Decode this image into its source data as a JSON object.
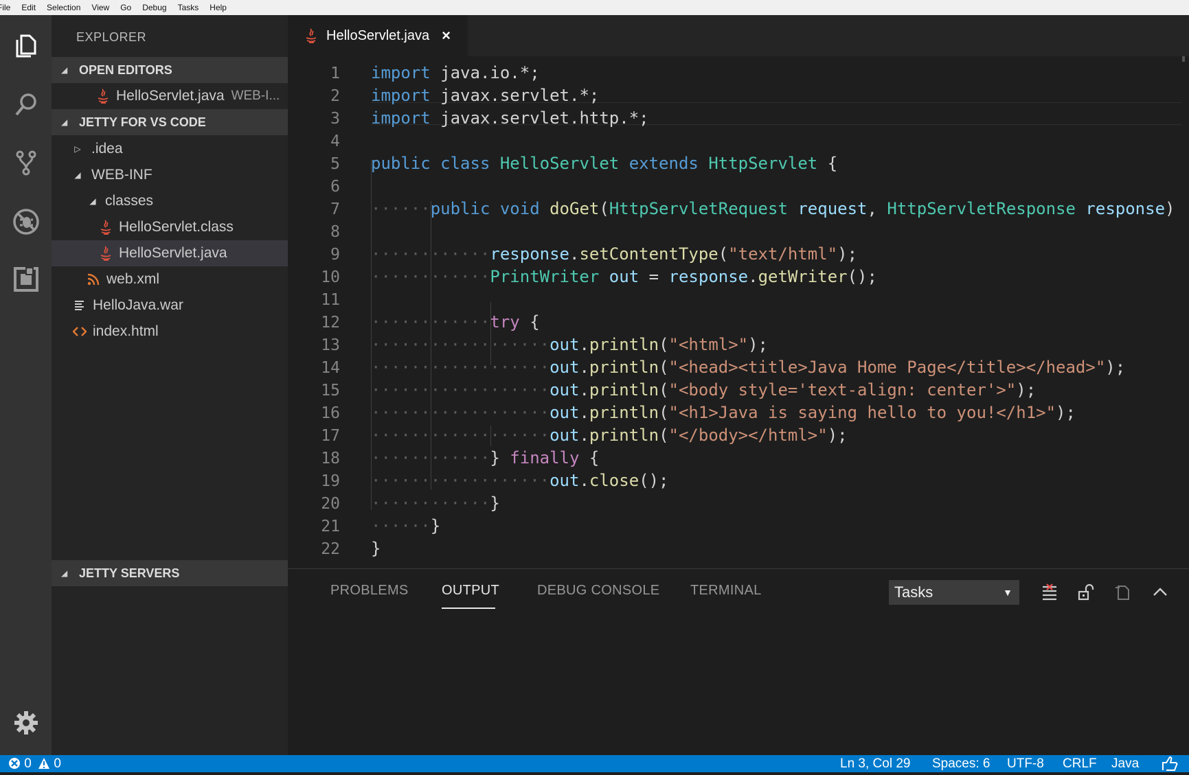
{
  "menubar": [
    "File",
    "Edit",
    "Selection",
    "View",
    "Go",
    "Debug",
    "Tasks",
    "Help"
  ],
  "activity_bar": {
    "items": [
      "files-icon",
      "search-icon",
      "source-control-icon",
      "debug-icon",
      "extensions-icon"
    ],
    "bottom": "settings-gear-icon"
  },
  "sidebar": {
    "title": "EXPLORER",
    "open_editors": {
      "header": "OPEN EDITORS",
      "items": [
        {
          "label": "HelloServlet.java",
          "description": "WEB-I..."
        }
      ]
    },
    "project": {
      "header": "JETTY FOR VS CODE",
      "items": [
        {
          "label": ".idea",
          "icon": "folder-collapsed"
        },
        {
          "label": "WEB-INF",
          "icon": "folder-expanded"
        },
        {
          "label": "classes",
          "icon": "folder-expanded"
        },
        {
          "label": "HelloServlet.class",
          "icon": "java-icon"
        },
        {
          "label": "HelloServlet.java",
          "icon": "java-icon",
          "selected": true
        },
        {
          "label": "web.xml",
          "icon": "xml-rss-icon"
        },
        {
          "label": "HelloJava.war",
          "icon": "file-lines-icon"
        },
        {
          "label": "index.html",
          "icon": "html-icon"
        }
      ]
    },
    "servers_header": "JETTY SERVERS"
  },
  "editor": {
    "tab": {
      "label": "HelloServlet.java",
      "close": "×"
    },
    "line_numbers": [
      "1",
      "2",
      "3",
      "4",
      "5",
      "6",
      "7",
      "8",
      "9",
      "10",
      "11",
      "12",
      "13",
      "14",
      "15",
      "16",
      "17",
      "18",
      "19",
      "20",
      "21",
      "22"
    ],
    "code": {
      "l1": {
        "a": "import",
        "b": " java.io.*;"
      },
      "l2": {
        "a": "import",
        "b": " javax.servlet.*;"
      },
      "l3": {
        "a": "import",
        "b": " javax.servlet.http.*;"
      },
      "l5": {
        "a": "public",
        "b": "class",
        "c": "HelloServlet",
        "d": "extends",
        "e": "HttpServlet",
        "f": " {"
      },
      "l7": {
        "ws": "······",
        "a": "public",
        "b": "void",
        "c": "doGet",
        "d": "(",
        "e": "HttpServletRequest",
        "f": "request",
        "g": ", ",
        "h": "HttpServletResponse",
        "i": "response",
        "j": ")"
      },
      "l9": {
        "ws": "············",
        "a": "response",
        "b": ".",
        "c": "setContentType",
        "d": "(",
        "e": "\"text/html\"",
        "f": ");"
      },
      "l10": {
        "ws": "············",
        "a": "PrintWriter",
        "b": "out",
        "c": " = ",
        "d": "response",
        "e": ".",
        "f": "getWriter",
        "g": "();"
      },
      "l12": {
        "ws": "············",
        "a": "try",
        "b": " {"
      },
      "l13": {
        "ws": "··················",
        "a": "out",
        "b": ".",
        "c": "println",
        "d": "(",
        "e": "\"<html>\"",
        "f": ");"
      },
      "l14": {
        "ws": "··················",
        "a": "out",
        "b": ".",
        "c": "println",
        "d": "(",
        "e": "\"<head><title>Java Home Page</title></head>\"",
        "f": ");"
      },
      "l15": {
        "ws": "··················",
        "a": "out",
        "b": ".",
        "c": "println",
        "d": "(",
        "e": "\"<body style='text-align: center'>\"",
        "f": ");"
      },
      "l16": {
        "ws": "··················",
        "a": "out",
        "b": ".",
        "c": "println",
        "d": "(",
        "e": "\"<h1>Java is saying hello to you!</h1>\"",
        "f": ");"
      },
      "l17": {
        "ws": "··················",
        "a": "out",
        "b": ".",
        "c": "println",
        "d": "(",
        "e": "\"</body></html>\"",
        "f": ");"
      },
      "l18": {
        "ws": "············",
        "a": "} ",
        "b": "finally",
        "c": " {"
      },
      "l19": {
        "ws": "··················",
        "a": "out",
        "b": ".",
        "c": "close",
        "d": "();"
      },
      "l20": {
        "ws": "············",
        "a": "}"
      },
      "l21": {
        "ws": "······",
        "a": "}"
      },
      "l22": {
        "a": "}"
      }
    }
  },
  "panel": {
    "tabs": [
      "PROBLEMS",
      "OUTPUT",
      "DEBUG CONSOLE",
      "TERMINAL"
    ],
    "active_tab": "OUTPUT",
    "task_select": {
      "value": "Tasks",
      "arrow": "▼"
    },
    "actions": [
      "clear-output-icon",
      "lock-scroll-icon",
      "open-in-editor-icon",
      "maximize-panel-icon"
    ]
  },
  "statusbar": {
    "errors": "0",
    "warnings": "0",
    "position": "Ln 3, Col 29",
    "spaces": "Spaces: 6",
    "encoding": "UTF-8",
    "eol": "CRLF",
    "language": "Java"
  },
  "colors": {
    "accent": "#007acc",
    "keyword": "#569cd6",
    "control": "#c586c0",
    "type": "#4ec9b0",
    "function": "#dcdcaa",
    "variable": "#9cdcfe",
    "string": "#ce9178"
  }
}
